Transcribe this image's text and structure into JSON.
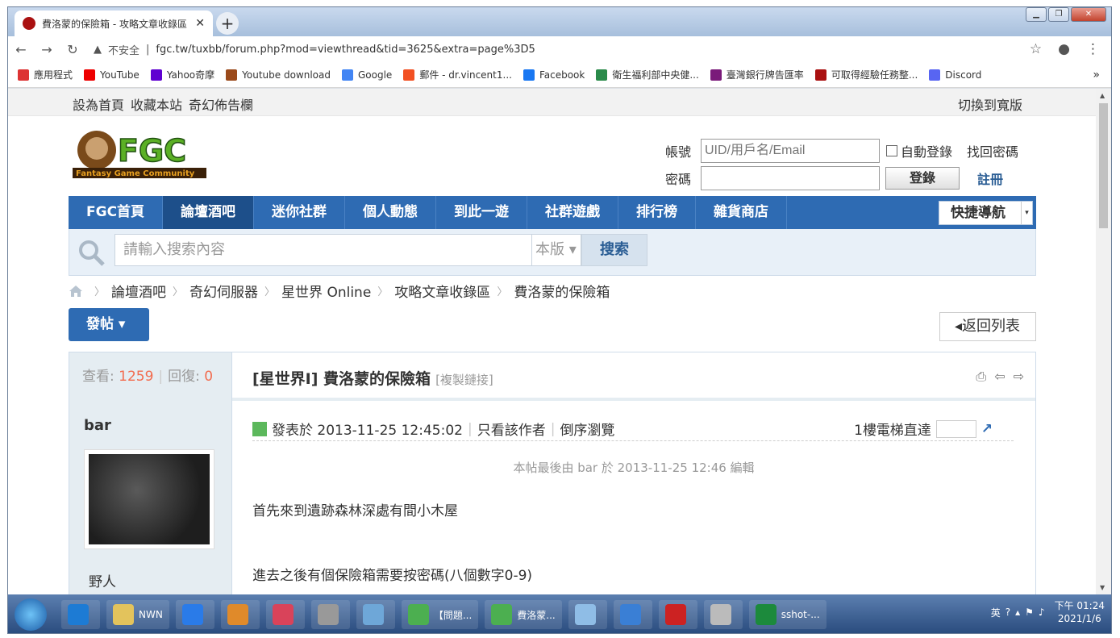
{
  "browser": {
    "tab_title": "費洛蒙的保險箱 - 攻略文章收錄區",
    "tab_close": "✕",
    "new_tab": "+",
    "security_label": "不安全",
    "url": "fgc.tw/tuxbb/forum.php?mod=viewthread&tid=3625&extra=page%3D5",
    "bookmarks": [
      {
        "label": "應用程式",
        "color": "#d33"
      },
      {
        "label": "YouTube",
        "color": "#e00"
      },
      {
        "label": "Yahoo奇摩",
        "color": "#5f01d1"
      },
      {
        "label": "Youtube download",
        "color": "#9b4a1b"
      },
      {
        "label": "Google",
        "color": "#4285f4"
      },
      {
        "label": "郵件 - dr.vincent1...",
        "color": "#f25022"
      },
      {
        "label": "Facebook",
        "color": "#1877f2"
      },
      {
        "label": "衛生福利部中央健...",
        "color": "#2a8a4a"
      },
      {
        "label": "臺灣銀行牌告匯率",
        "color": "#7a1a7a"
      },
      {
        "label": "可取得經驗任務整...",
        "color": "#a11"
      },
      {
        "label": "Discord",
        "color": "#5865f2"
      }
    ],
    "bookmarks_more": "»"
  },
  "topbar": {
    "left": [
      "設為首頁",
      "收藏本站",
      "奇幻佈告欄"
    ],
    "right": "切換到寬版"
  },
  "logo": {
    "text": "FGC",
    "sub": "Fantasy Game Community"
  },
  "login": {
    "account_label": "帳號",
    "account_placeholder": "UID/用戶名/Email",
    "auto_login": "自動登錄",
    "forgot": "找回密碼",
    "password_label": "密碼",
    "login_button": "登錄",
    "register": "註冊"
  },
  "nav": {
    "items": [
      "FGC首頁",
      "論壇酒吧",
      "迷你社群",
      "個人動態",
      "到此一遊",
      "社群遊戲",
      "排行榜",
      "雜貨商店"
    ],
    "active_index": 1,
    "quick": "快捷導航",
    "quick_arrow": "▾"
  },
  "search": {
    "placeholder": "請輸入搜索內容",
    "scope": "本版 ▾",
    "button": "搜索"
  },
  "breadcrumb": [
    "論壇酒吧",
    "奇幻伺服器",
    "星世界 Online",
    "攻略文章收錄區",
    "費洛蒙的保險箱"
  ],
  "post_button": "發帖 ▾",
  "back_button": "◂返回列表",
  "thread": {
    "views_label": "查看:",
    "views": "1259",
    "replies_label": "回復:",
    "replies": "0",
    "title": "[星世界I] 費洛蒙的保險箱",
    "copy_link": "[複製鏈接]",
    "author": "bar",
    "rank": "野人",
    "posted": "發表於 2013-11-25 12:45:02",
    "only_author": "只看該作者",
    "reverse": "倒序瀏覽",
    "floor": "1樓",
    "lift": "電梯直達",
    "edited": "本帖最後由 bar 於 2013-11-25 12:46 編輯",
    "content": [
      "首先來到遺跡森林深處有間小木屋",
      "進去之後有個保險箱需要按密碼(八個數字0-9)"
    ]
  },
  "taskbar": {
    "items": [
      {
        "label": "",
        "color": "#1d7bd4"
      },
      {
        "label": "NWN",
        "color": "#e3c35c"
      },
      {
        "label": "",
        "color": "#2a7be8"
      },
      {
        "label": "",
        "color": "#e08a2a"
      },
      {
        "label": "",
        "color": "#d9435a"
      },
      {
        "label": "",
        "color": "#999"
      },
      {
        "label": "",
        "color": "#6ea7d8"
      },
      {
        "label": "【問題...",
        "color": "#4caf50"
      },
      {
        "label": "費洛蒙...",
        "color": "#4caf50"
      },
      {
        "label": "",
        "color": "#8fbde6"
      },
      {
        "label": "",
        "color": "#3a7fd5"
      },
      {
        "label": "",
        "color": "#c22"
      },
      {
        "label": "",
        "color": "#bbb"
      },
      {
        "label": "sshot-...",
        "color": "#1c8a3c"
      }
    ],
    "ime": "英",
    "time": "下午 01:24",
    "date": "2021/1/6"
  }
}
